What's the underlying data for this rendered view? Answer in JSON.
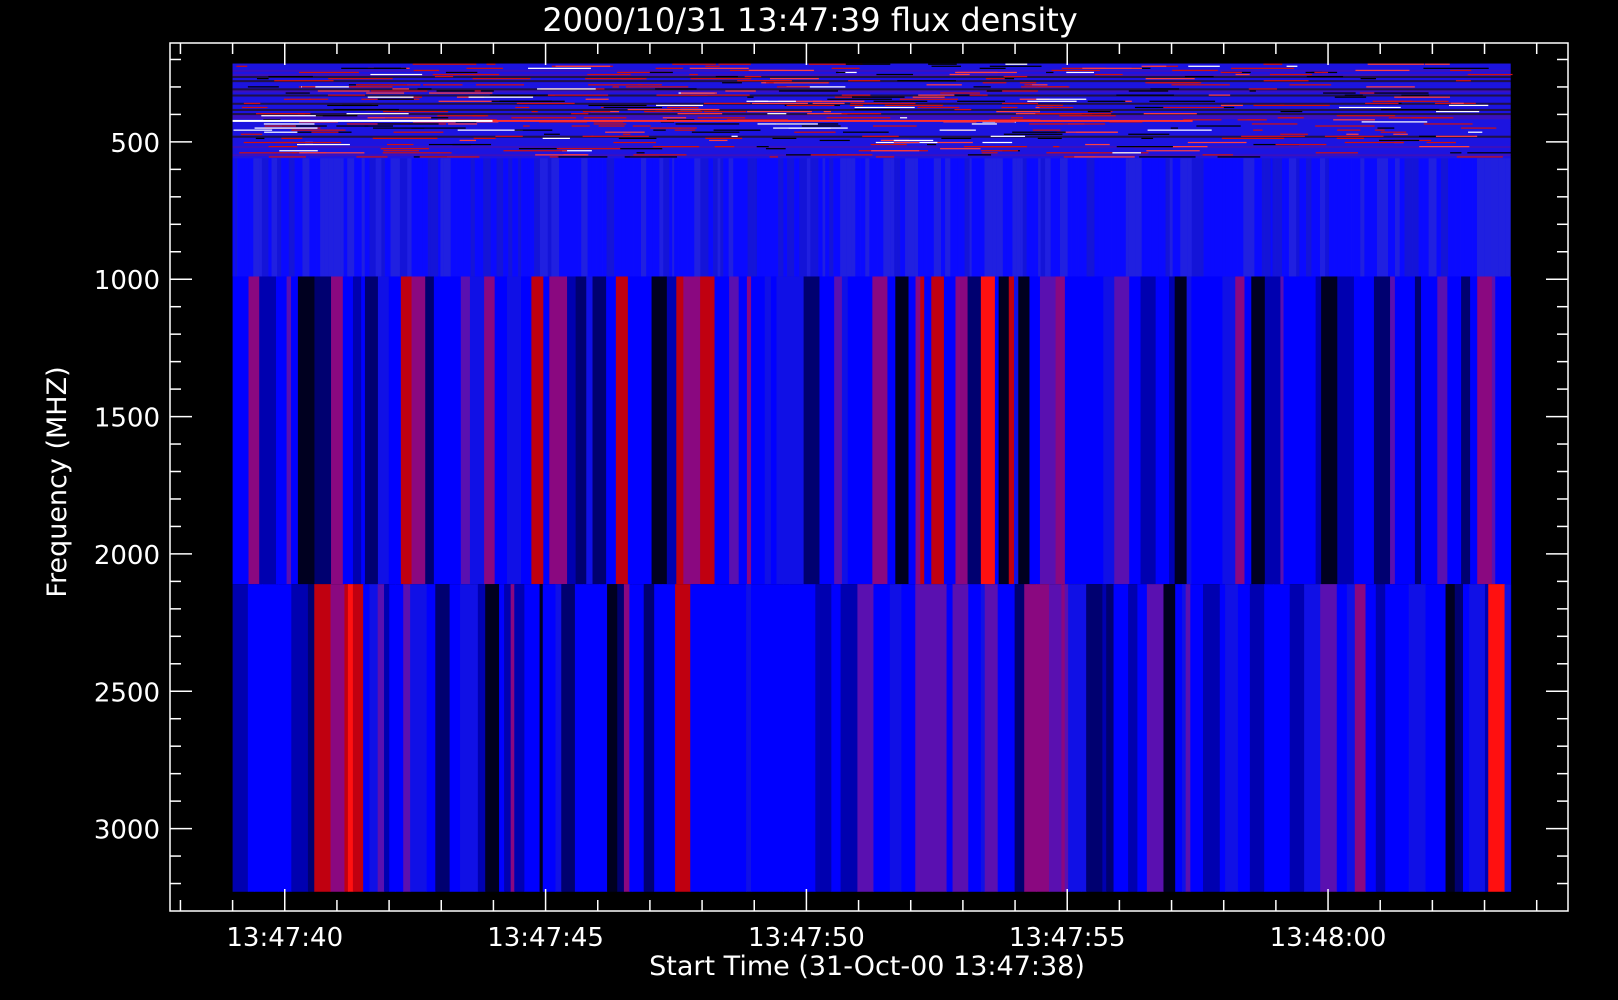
{
  "chart_data": {
    "type": "heatmap",
    "title": "2000/10/31 13:47:39 flux density",
    "xlabel": "Start Time (31-Oct-00 13:47:38)",
    "ylabel": "Frequency (MHZ)",
    "x_tick_labels": [
      "13:47:40",
      "13:47:45",
      "13:47:50",
      "13:47:55",
      "13:48:00"
    ],
    "y_tick_labels": [
      "500",
      "1000",
      "1500",
      "2000",
      "2500",
      "3000"
    ],
    "x_ticks_seconds_from_start": [
      2,
      7,
      12,
      17,
      22
    ],
    "y_ticks": [
      500,
      1000,
      1500,
      2000,
      2500,
      3000
    ],
    "xlim_seconds_from_start": [
      -0.2,
      26.6
    ],
    "ylim": [
      3300,
      140
    ],
    "data_time_range_seconds_from_start": [
      1,
      25.5
    ],
    "frequency_bands": [
      {
        "name": "band-1",
        "freq_range": [
          215,
          560
        ],
        "pattern": "noisy-speckle"
      },
      {
        "name": "band-2",
        "freq_range": [
          560,
          990
        ],
        "pattern": "uniform-blue-columns"
      },
      {
        "name": "band-3",
        "freq_range": [
          990,
          2110
        ],
        "pattern": "vertical-stripes"
      },
      {
        "name": "band-4",
        "freq_range": [
          2110,
          3230
        ],
        "pattern": "vertical-stripes"
      }
    ],
    "colormap": [
      "#000000",
      "#000080",
      "#0000ff",
      "#8000a0",
      "#c00000",
      "#ff0000",
      "#ff8000",
      "#ffffff"
    ],
    "grid": false,
    "legend": "none"
  },
  "colors": {
    "background": "#000000",
    "axes": "#ffffff",
    "text": "#ffffff"
  }
}
